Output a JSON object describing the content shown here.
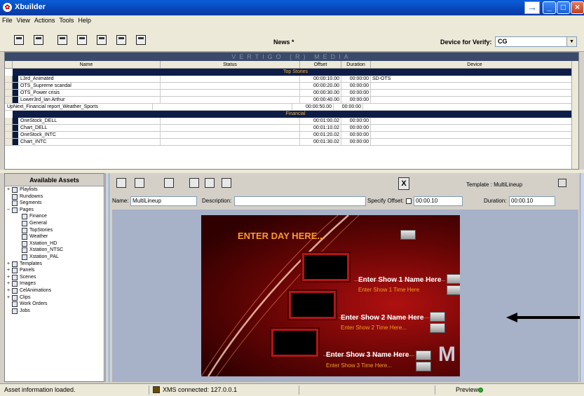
{
  "window": {
    "title": "Xbuilder"
  },
  "menu": [
    "File",
    "View",
    "Actions",
    "Tools",
    "Help"
  ],
  "toolbar": {
    "rundown_name": "News *",
    "device_label": "Device for Verify:",
    "device_value": "CG"
  },
  "grid": {
    "banner": "VERTIGO (R) MEDIA",
    "columns": [
      "Name",
      "Status",
      "Offset",
      "Duration",
      "Device"
    ],
    "sections": [
      {
        "title": "Top Stories",
        "rows": [
          {
            "name": "L3rd_Animated",
            "status": "",
            "offset": "00:00:10.00",
            "duration": "00:00:00",
            "device": "SD-OTS"
          },
          {
            "name": "OTS_Supreme scandal",
            "status": "",
            "offset": "00:00:20.00",
            "duration": "00:00:00",
            "device": ""
          },
          {
            "name": "OTS_Power crisis",
            "status": "",
            "offset": "00:00:30.00",
            "duration": "00:00:00",
            "device": ""
          },
          {
            "name": "Lower3rd_Ian Arthur",
            "status": "",
            "offset": "00:00:40.00",
            "duration": "00:00:00",
            "device": ""
          },
          {
            "name": "UpNext_Financial report_Weather_Sports",
            "status": "",
            "offset": "00:00:50.00",
            "duration": "00:00:00",
            "device": ""
          }
        ]
      },
      {
        "title": "Financial",
        "rows": [
          {
            "name": "OneStock_DELL",
            "status": "",
            "offset": "00:01:00.02",
            "duration": "00:00:00",
            "device": ""
          },
          {
            "name": "Chart_DELL",
            "status": "",
            "offset": "00:01:10.02",
            "duration": "00:00:00",
            "device": ""
          },
          {
            "name": "OneStock_INTC",
            "status": "",
            "offset": "00:01:20.02",
            "duration": "00:00:00",
            "device": ""
          },
          {
            "name": "Chart_INTC",
            "status": "",
            "offset": "00:01:30.02",
            "duration": "00:00:00",
            "device": ""
          }
        ]
      }
    ]
  },
  "assets": {
    "title": "Available Assets",
    "items": [
      {
        "label": "Playlists",
        "expander": "+",
        "level": 0
      },
      {
        "label": "Rundowns",
        "expander": "",
        "level": 0
      },
      {
        "label": "Segments",
        "expander": "",
        "level": 0
      },
      {
        "label": "Pages",
        "expander": "−",
        "level": 0
      },
      {
        "label": "Finance",
        "expander": "",
        "level": 1
      },
      {
        "label": "General",
        "expander": "",
        "level": 1
      },
      {
        "label": "TopStories",
        "expander": "",
        "level": 1
      },
      {
        "label": "Weather",
        "expander": "",
        "level": 1
      },
      {
        "label": "Xstation_HD",
        "expander": "",
        "level": 1
      },
      {
        "label": "Xstation_NTSC",
        "expander": "",
        "level": 1
      },
      {
        "label": "Xstation_PAL",
        "expander": "",
        "level": 1
      },
      {
        "label": "Templates",
        "expander": "+",
        "level": 0
      },
      {
        "label": "Panels",
        "expander": "+",
        "level": 0
      },
      {
        "label": "Scenes",
        "expander": "+",
        "level": 0
      },
      {
        "label": "Images",
        "expander": "+",
        "level": 0
      },
      {
        "label": "CelAnimations",
        "expander": "+",
        "level": 0
      },
      {
        "label": "Clips",
        "expander": "+",
        "level": 0
      },
      {
        "label": "Work Orders",
        "expander": "",
        "level": 0
      },
      {
        "label": "Jobs",
        "expander": "",
        "level": 0
      }
    ]
  },
  "editor": {
    "close_label": "X",
    "template_label": "Template : MultiLineup",
    "name_label": "Name:",
    "name_value": "MultiLineup",
    "description_label": "Description:",
    "description_value": "",
    "specify_offset_label": "Specify Offset:",
    "offset_value": "00:00.10",
    "duration_label": "Duration:",
    "duration_value": "00:00.10"
  },
  "template": {
    "day_text": "ENTER DAY HERE...",
    "shows": [
      {
        "name": "Enter Show 1 Name Here",
        "time": "Enter Show 1 Time Here"
      },
      {
        "name": "Enter Show 2 Name Here",
        "time": "Enter Show 2 Time Here..."
      },
      {
        "name": "Enter Show 3 Name Here",
        "time": "Enter Show 3 Time Here..."
      }
    ],
    "logo": "M"
  },
  "status": {
    "message": "Asset information loaded.",
    "connection": "XMS connected: 127.0.0.1",
    "preview": "Preview"
  },
  "colors": {
    "titlebar": "#0a5ed8",
    "section_header": "#0d1d48",
    "section_text": "#f6b43c",
    "template_bg": "#6a0505",
    "show_time": "#f2a01f"
  }
}
